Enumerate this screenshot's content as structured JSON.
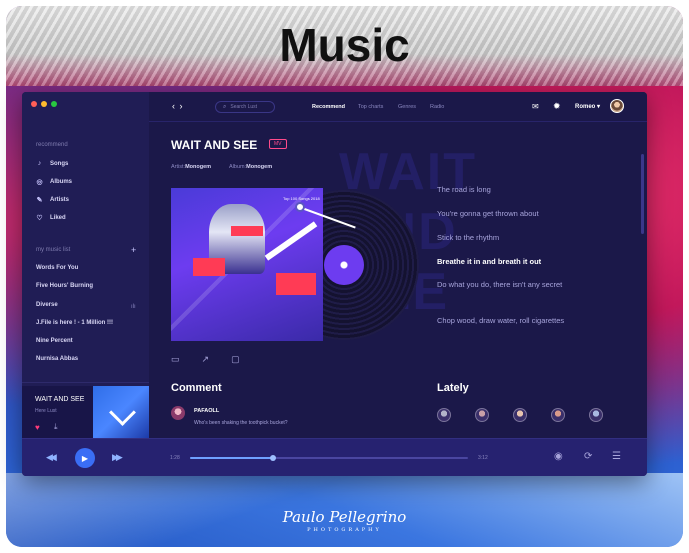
{
  "page": {
    "title": "Music"
  },
  "signature": {
    "name": "Paulo Pellegrino",
    "subtitle": "PHOTOGRAPHY"
  },
  "window": {
    "traffic_colors": [
      "#ff5f57",
      "#febc2e",
      "#28c840"
    ]
  },
  "sidebar": {
    "section_label": "recommend",
    "items": [
      {
        "label": "Songs",
        "icon": "music-note-icon"
      },
      {
        "label": "Albums",
        "icon": "disc-icon"
      },
      {
        "label": "Artists",
        "icon": "microphone-icon"
      },
      {
        "label": "Liked",
        "icon": "heart-icon"
      }
    ],
    "playlist_label": "my music list",
    "playlists": [
      "Words For You",
      "Five Hours' Burning",
      "Diverse",
      "J.File is here ! - 1 Million !!!",
      "Nine Percent",
      "Nurnisa Abbas"
    ]
  },
  "now_playing": {
    "title": "WAIT AND SEE",
    "artist": "Here Lust"
  },
  "topbar": {
    "search_placeholder": "Search Lust",
    "tabs": [
      "Recommend",
      "Top charts",
      "Genres",
      "Radio"
    ],
    "user": "Romeo"
  },
  "song": {
    "title": "WAIT AND SEE",
    "badge": "MV",
    "artist_label": "Artist:",
    "artist": "Monogem",
    "album_label": "Album:",
    "album": "Monogem",
    "background_text": [
      "WAIT",
      "AND",
      "SEE"
    ],
    "album_art_label": "Top 100 Songs 2018"
  },
  "lyrics": [
    {
      "text": "The road is long",
      "active": false
    },
    {
      "text": "You're gonna get thrown about",
      "active": false
    },
    {
      "text": "Stick to the rhythm",
      "active": false
    },
    {
      "text": "Breathe it in and breath it out",
      "active": true
    },
    {
      "text": "Do what you do, there isn't any secret",
      "active": false
    },
    {
      "text": "Chop wood, draw water, roll cigarettes",
      "active": false
    }
  ],
  "comment": {
    "title": "Comment",
    "user": "PAFAOLL",
    "text": "Who's been shaking the toothpick bucket?"
  },
  "lately": {
    "title": "Lately",
    "avatar_colors": [
      "#b3b3c9",
      "#c9a0a8",
      "#e8c4b0",
      "#d99a8a",
      "#a8b8e0"
    ]
  },
  "player": {
    "time_current": "1:28",
    "time_total": "3:12",
    "progress": 0.3,
    "accent": "#3a6ef5"
  }
}
